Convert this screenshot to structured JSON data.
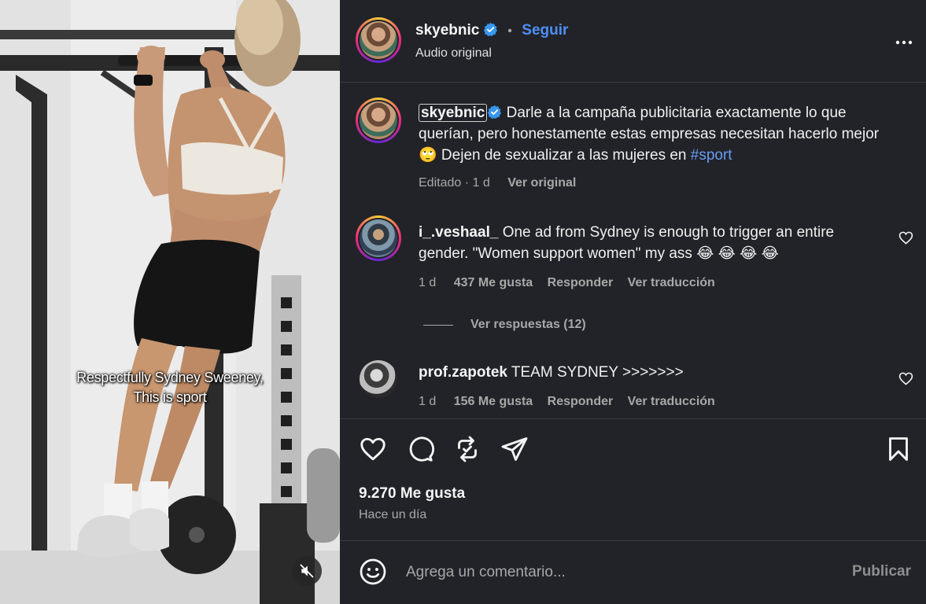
{
  "video": {
    "caption_line1": "Respectfully Sydney Sweeney,",
    "caption_line2": "This is sport",
    "mute_icon": "speaker-muted-icon"
  },
  "header": {
    "username": "skyebnic",
    "separator": "•",
    "follow_label": "Seguir",
    "subtitle": "Audio original",
    "more_icon": "more-options-icon"
  },
  "caption_comment": {
    "username": "skyebnic",
    "text": "Darle a la campaña publicitaria exactamente lo que querían, pero honestamente estas empresas necesitan hacerlo mejor 🙄 Dejen de sexualizar a las mujeres en ",
    "hashtag": "#sport",
    "edited": "Editado · 1 d",
    "view_original": "Ver original"
  },
  "comments": [
    {
      "username": "i_.veshaal_",
      "text": "One ad from Sydney is enough to trigger an entire gender. \"Women support women\" my ass 😂 😂 😂 😂",
      "age": "1 d",
      "likes": "437 Me gusta",
      "reply": "Responder",
      "translate": "Ver traducción",
      "view_replies": "Ver respuestas (12)"
    },
    {
      "username": "prof.zapotek",
      "text": "TEAM SYDNEY >>>>>>>",
      "age": "1 d",
      "likes": "156 Me gusta",
      "reply": "Responder",
      "translate": "Ver traducción"
    }
  ],
  "actions": {
    "like_icon": "heart-icon",
    "comment_icon": "comment-icon",
    "repost_icon": "repost-icon",
    "share_icon": "share-icon",
    "save_icon": "bookmark-icon"
  },
  "stats": {
    "likes": "9.270 Me gusta",
    "time": "Hace un día"
  },
  "add_comment": {
    "placeholder": "Agrega un comentario...",
    "publish_label": "Publicar",
    "emoji_icon": "emoji-icon"
  },
  "colors": {
    "panel_bg": "#212328",
    "accent_blue": "#4f8ff7",
    "hashtag_blue": "#6a9cf6",
    "muted_text": "#a8a8a8"
  }
}
